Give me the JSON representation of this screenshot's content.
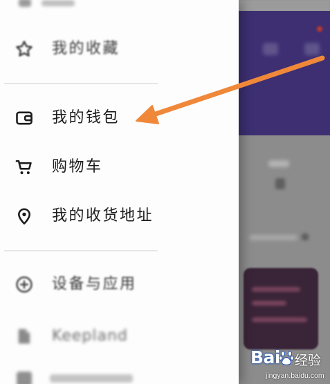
{
  "drawer": {
    "sections": [
      {
        "items": [
          {
            "label": "我的收藏",
            "icon": "star-icon"
          }
        ]
      },
      {
        "items": [
          {
            "label": "我的钱包",
            "icon": "wallet-icon"
          },
          {
            "label": "购物车",
            "icon": "cart-icon"
          },
          {
            "label": "我的收货地址",
            "icon": "location-pin-icon"
          }
        ]
      },
      {
        "items": [
          {
            "label": "设备与应用",
            "icon": "plus-circle-icon"
          },
          {
            "label": "Keepland",
            "icon": "document-icon"
          }
        ]
      }
    ]
  },
  "watermark": {
    "brand": "Bai",
    "product": "经验",
    "url": "jingyan.baidu.com",
    "icon": "baidu-paw-icon"
  },
  "colors": {
    "drawer_bg": "#fdfdfd",
    "backdrop_purple": "#3d2f72",
    "backdrop_gray": "#8c8c8c",
    "card": "#3a2438",
    "arrow": "#f0883a",
    "icon_dark": "#1c1c1c"
  }
}
